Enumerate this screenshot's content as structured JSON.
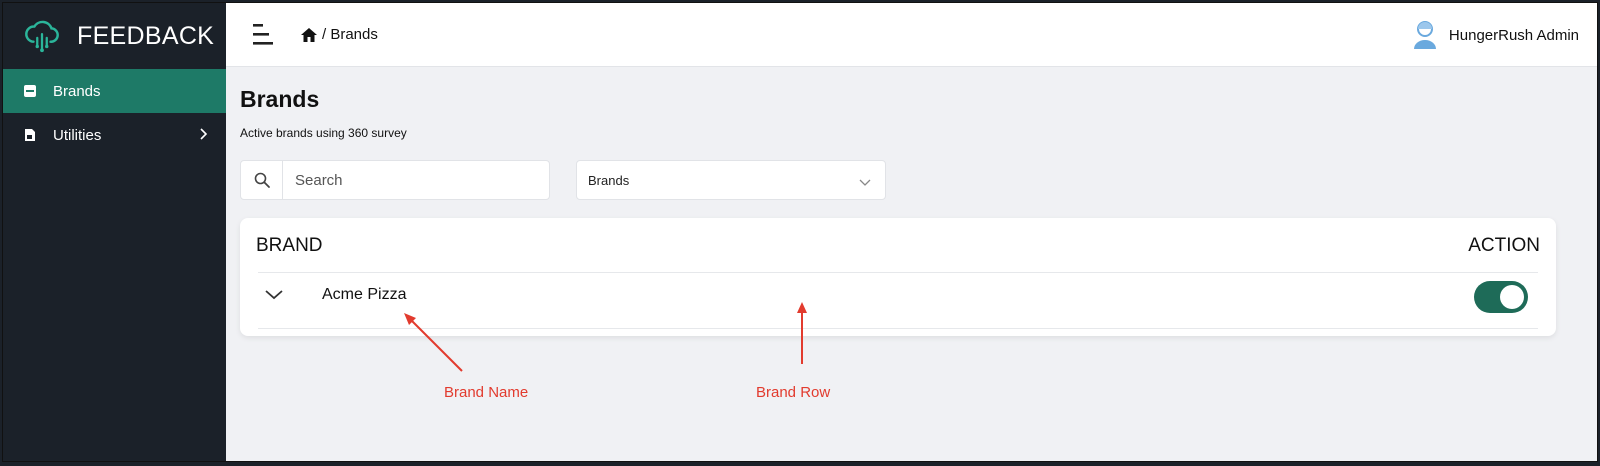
{
  "sidebar": {
    "app_name": "FEEDBACK",
    "items": [
      {
        "label": "Brands",
        "icon": "store-icon",
        "active": true
      },
      {
        "label": "Utilities",
        "icon": "document-icon",
        "active": false
      }
    ]
  },
  "header": {
    "breadcrumb": "/ Brands",
    "user_name": "HungerRush Admin"
  },
  "main": {
    "title": "Brands",
    "subtitle": "Active brands using 360 survey",
    "search": {
      "placeholder": "Search",
      "value": ""
    },
    "filter": {
      "selected": "Brands"
    },
    "table": {
      "columns": [
        "BRAND",
        "ACTION"
      ],
      "rows": [
        {
          "brand": "Acme Pizza",
          "enabled": true
        }
      ]
    }
  },
  "annotations": {
    "brand_name": "Brand Name",
    "brand_row": "Brand Row"
  },
  "colors": {
    "sidebar_bg": "#1b2129",
    "accent": "#1e7a67",
    "toggle_on": "#1e6b58",
    "annotation": "#e23b2e"
  }
}
